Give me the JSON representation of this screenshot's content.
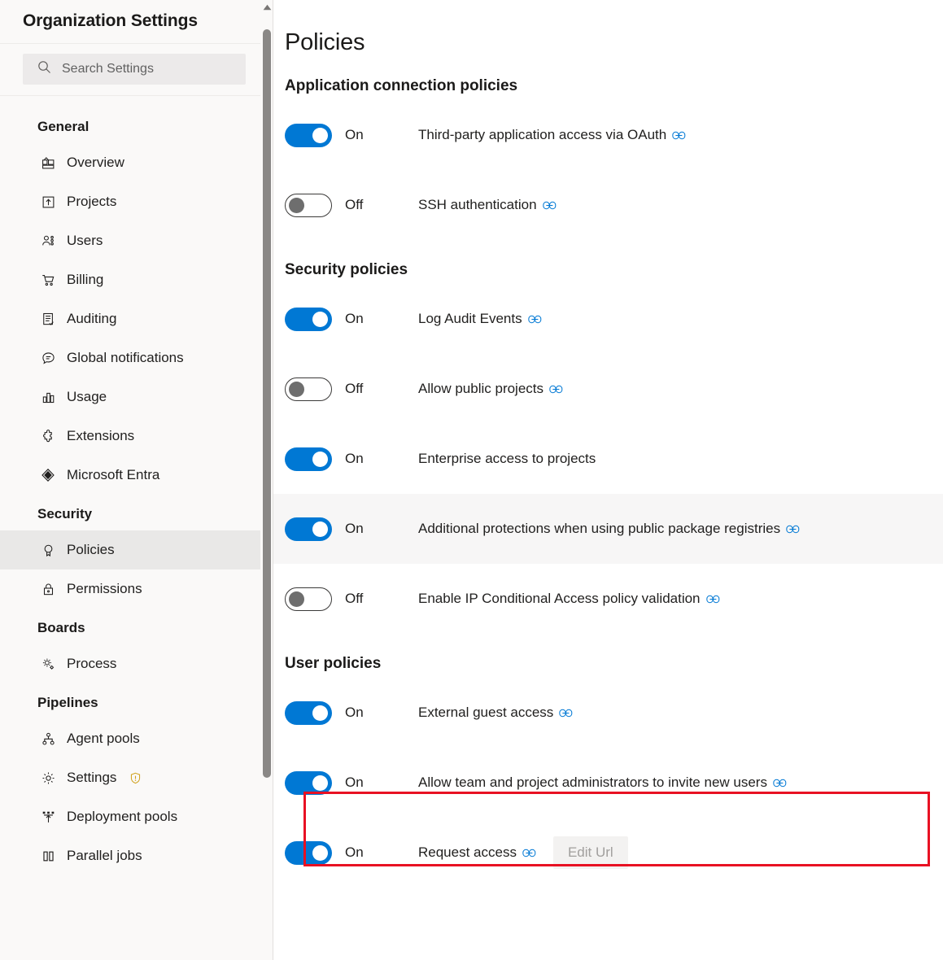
{
  "sidebar": {
    "title": "Organization Settings",
    "search": {
      "placeholder": "Search Settings",
      "icon": "search-icon"
    },
    "groups": [
      {
        "title": "General",
        "items": [
          {
            "label": "Overview",
            "icon": "overview-icon",
            "selected": false
          },
          {
            "label": "Projects",
            "icon": "projects-icon",
            "selected": false
          },
          {
            "label": "Users",
            "icon": "users-icon",
            "selected": false
          },
          {
            "label": "Billing",
            "icon": "billing-cart-icon",
            "selected": false
          },
          {
            "label": "Auditing",
            "icon": "auditing-icon",
            "selected": false
          },
          {
            "label": "Global notifications",
            "icon": "notifications-icon",
            "selected": false
          },
          {
            "label": "Usage",
            "icon": "usage-chart-icon",
            "selected": false
          },
          {
            "label": "Extensions",
            "icon": "extensions-icon",
            "selected": false
          },
          {
            "label": "Microsoft Entra",
            "icon": "microsoft-entra-icon",
            "selected": false
          }
        ]
      },
      {
        "title": "Security",
        "items": [
          {
            "label": "Policies",
            "icon": "policies-ribbon-icon",
            "selected": true
          },
          {
            "label": "Permissions",
            "icon": "lock-icon",
            "selected": false
          }
        ]
      },
      {
        "title": "Boards",
        "items": [
          {
            "label": "Process",
            "icon": "process-gear-icon",
            "selected": false
          }
        ]
      },
      {
        "title": "Pipelines",
        "items": [
          {
            "label": "Agent pools",
            "icon": "agent-pools-icon",
            "selected": false
          },
          {
            "label": "Settings",
            "icon": "gear-icon",
            "selected": false,
            "badge": "warning-shield-icon"
          },
          {
            "label": "Deployment pools",
            "icon": "deployment-pools-icon",
            "selected": false
          },
          {
            "label": "Parallel jobs",
            "icon": "parallel-jobs-icon",
            "selected": false
          }
        ]
      }
    ],
    "scrollbar": {
      "up_arrow": "scroll-up-arrow-icon"
    }
  },
  "main": {
    "title": "Policies",
    "sections": [
      {
        "title": "Application connection policies",
        "policies": [
          {
            "state": "On",
            "on": true,
            "label": "Third-party application access via OAuth",
            "link": true,
            "hover": false
          },
          {
            "state": "Off",
            "on": false,
            "label": "SSH authentication",
            "link": true,
            "hover": false
          }
        ]
      },
      {
        "title": "Security policies",
        "policies": [
          {
            "state": "On",
            "on": true,
            "label": "Log Audit Events",
            "link": true,
            "hover": false
          },
          {
            "state": "Off",
            "on": false,
            "label": "Allow public projects",
            "link": true,
            "hover": false
          },
          {
            "state": "On",
            "on": true,
            "label": "Enterprise access to projects",
            "link": false,
            "hover": false
          },
          {
            "state": "On",
            "on": true,
            "label": "Additional protections when using public package registries",
            "link": true,
            "hover": true
          },
          {
            "state": "Off",
            "on": false,
            "label": "Enable IP Conditional Access policy validation",
            "link": true,
            "hover": false
          }
        ]
      },
      {
        "title": "User policies",
        "policies": [
          {
            "state": "On",
            "on": true,
            "label": "External guest access",
            "link": true,
            "hover": false
          },
          {
            "state": "On",
            "on": true,
            "label": "Allow team and project administrators to invite new users",
            "link": true,
            "hover": false,
            "highlighted": true
          },
          {
            "state": "On",
            "on": true,
            "label": "Request access",
            "link": true,
            "hover": false,
            "button": "Edit Url"
          }
        ]
      }
    ]
  },
  "colors": {
    "accent": "#0078d4",
    "highlight_box": "#e81123",
    "sidebar_bg": "#faf9f8",
    "selected_row": "#e9e8e7",
    "hover_row": "#f7f6f6",
    "warning_shield": "#d0a11b",
    "disabled_button_text": "#a19f9d"
  }
}
